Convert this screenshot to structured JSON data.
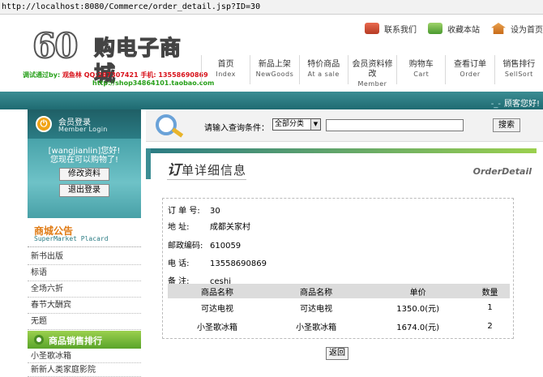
{
  "url": "http://localhost:8080/Commerce/order_detail.jsp?ID=30",
  "header": {
    "logo_num": "60",
    "logo_name": "购电子商城",
    "toplinks": [
      {
        "label": "联系我们",
        "icon": "phone-icon"
      },
      {
        "label": "收藏本站",
        "icon": "bookmark-icon"
      },
      {
        "label": "设为首页",
        "icon": "home-icon"
      }
    ],
    "debug": {
      "prefix": "调试通过by:",
      "author": "观鱼林",
      "qq": "QQ:287307421",
      "phone": "手机: 13558690869",
      "site": "http://shop34864101.taobao.com"
    },
    "nav": [
      {
        "cn": "首页",
        "en": "Index"
      },
      {
        "cn": "新品上架",
        "en": "NewGoods"
      },
      {
        "cn": "特价商品",
        "en": "At a sale"
      },
      {
        "cn": "会员资料修改",
        "en": "Member"
      },
      {
        "cn": "购物车",
        "en": "Cart"
      },
      {
        "cn": "查看订单",
        "en": "Order"
      },
      {
        "cn": "销售排行",
        "en": "SellSort"
      }
    ],
    "welcome_dots": "-_-",
    "welcome": "顾客您好!"
  },
  "login": {
    "title": "会员登录",
    "subtitle": "Member Login",
    "msg1": "[wangjianlin]您好!",
    "msg2": "您现在可以购物了!",
    "edit_btn": "修改资料",
    "logout_btn": "退出登录"
  },
  "placard": {
    "title": "商城公告",
    "subtitle": "SuperMarket Placard",
    "items": [
      "新书出版",
      "标语",
      "全场六折",
      "春节大酬宾",
      "无题"
    ]
  },
  "rank": {
    "title": "商品销售排行",
    "items": [
      "小圣歌冰箱",
      "新新人类家庭影院"
    ]
  },
  "search": {
    "label": "请输入查询条件：",
    "category": "全部分类",
    "keyword": "",
    "button": "搜索"
  },
  "panel": {
    "title_first": "订",
    "title_rest": "单详细信息",
    "title_en": "OrderDetail"
  },
  "order": {
    "fields": [
      {
        "label": "订 单 号:",
        "value": "30"
      },
      {
        "label": "地    址:",
        "value": "成都关家村"
      },
      {
        "label": "邮政编码:",
        "value": "610059"
      },
      {
        "label": "电    话:",
        "value": "13558690869"
      },
      {
        "label": "备    注:",
        "value": "ceshi"
      }
    ],
    "columns": [
      "商品名称",
      "商品名称",
      "单价",
      "数量"
    ],
    "rows": [
      [
        "可达电视",
        "可达电视",
        "1350.0(元)",
        "1"
      ],
      [
        "小圣歌冰箱",
        "小圣歌冰箱",
        "1674.0(元)",
        "2"
      ]
    ],
    "back_btn": "返回"
  }
}
